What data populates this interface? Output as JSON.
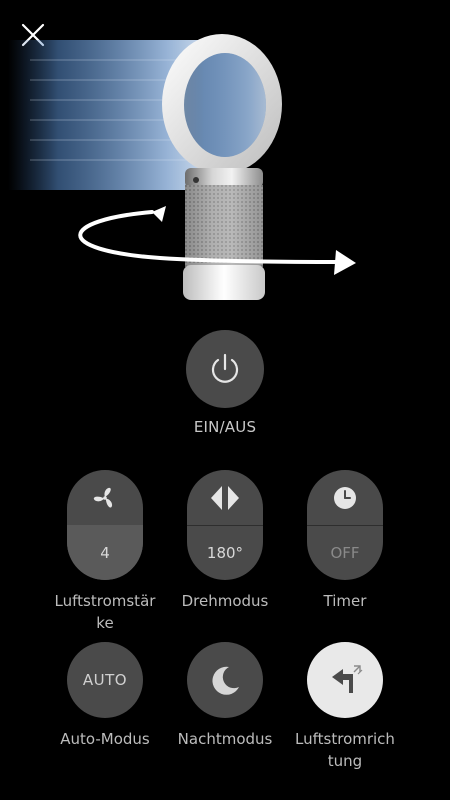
{
  "hero": {
    "image": "dyson-fan-oscillation-illustration"
  },
  "power": {
    "label": "EIN/AUS",
    "icon": "power-icon"
  },
  "controls": {
    "airflow": {
      "value": "4",
      "label_line1": "Luftstromstär",
      "label_line2": "ke",
      "icon": "fan-icon"
    },
    "rotation": {
      "value": "180°",
      "label_line1": "Drehmodus",
      "icon": "oscillation-icon"
    },
    "timer": {
      "value": "OFF",
      "label_line1": "Timer",
      "icon": "clock-icon"
    },
    "auto": {
      "text": "AUTO",
      "label_line1": "Auto-Modus"
    },
    "night": {
      "label_line1": "Nachtmodus",
      "icon": "moon-icon"
    },
    "direction": {
      "label_line1": "Luftstromrich",
      "label_line2": "tung",
      "icon": "airflow-direction-icon"
    }
  },
  "colors": {
    "background": "#000000",
    "button": "#4a4a4a",
    "text": "#bdbdbd"
  }
}
